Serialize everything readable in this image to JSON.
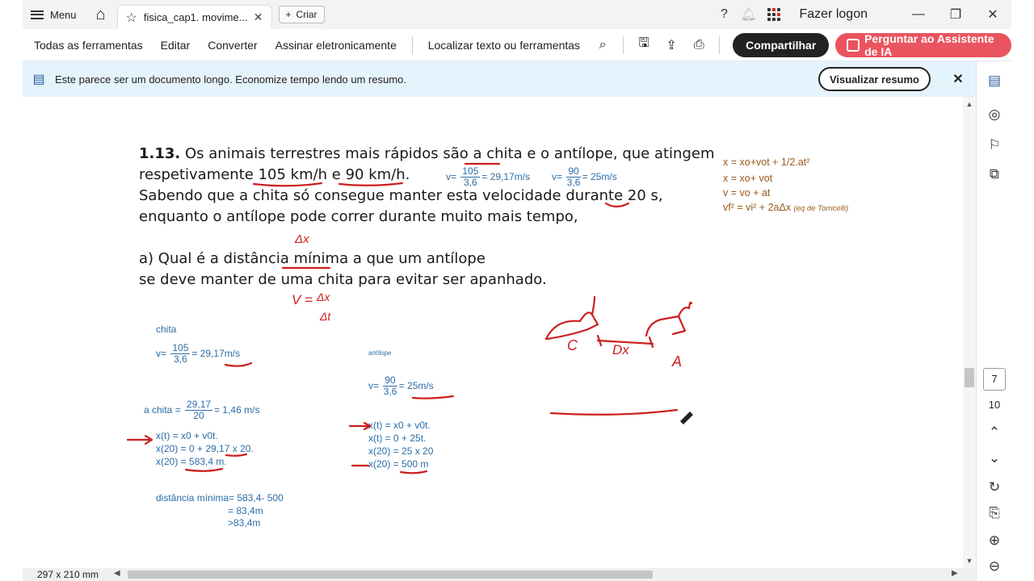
{
  "titlebar": {
    "menu_label": "Menu",
    "tab_title": "fisica_cap1. movime...",
    "create_label": "Criar",
    "logon_label": "Fazer logon"
  },
  "toolbar": {
    "items": [
      "Todas as ferramentas",
      "Editar",
      "Converter",
      "Assinar eletronicamente"
    ],
    "find_label": "Localizar texto ou ferramentas",
    "share_label": "Compartilhar",
    "ai_label": "Perguntar ao Assistente de IA"
  },
  "banner": {
    "text": "Este parece ser um documento longo. Economize tempo lendo um resumo.",
    "button_label": "Visualizar resumo"
  },
  "navigation": {
    "current_page": "7",
    "total_pages": "10"
  },
  "statusbar": {
    "page_size": "297 x 210 mm"
  },
  "document": {
    "question_number": "1.13.",
    "line1_rest": "Os animais terrestres mais rápidos são a chita e o antílope, que atingem",
    "line2": "respetivamente 105 km/h e 90 km/h.",
    "line3": "Sabendo que a chita só consegue manter esta velocidade durante 20 s,",
    "line4": "enquanto o antílope pode correr durante muito mais tempo,",
    "line5": "a) Qual é a distância mínima a que um antílope",
    "line6": "se deve manter de uma chita para evitar ser apanhado.",
    "top_calc": {
      "v1_label": "v=",
      "v1_num": "105",
      "v1_den": "3,6",
      "v1_result": "= 29,17m/s",
      "v2_label": "v=",
      "v2_num": "90",
      "v2_den": "3,6",
      "v2_result": "= 25m/s"
    },
    "formulas": [
      "x = xo+vot + 1/2.at²",
      "x = xo+ vot",
      "v = vo + at",
      "vf² = vi² + 2aΔx"
    ],
    "torricelli_note": "(eq de Torricelli)",
    "chita": {
      "title": "chita",
      "v_label": "v=",
      "v_num": "105",
      "v_den": "3,6",
      "v_result": "= 29,17m/s",
      "a_label": "a chita =",
      "a_num": "29,17",
      "a_den": "20",
      "a_result": "= 1,46 m/s",
      "x_lines": [
        "x(t) = x0 + v0t.",
        "x(20) = 0 + 29,17 x 20.",
        "x(20) = 583,4 m."
      ]
    },
    "antilope": {
      "title": "antílope",
      "v_label": "v=",
      "v_num": "90",
      "v_den": "3,6",
      "v_result": "= 25m/s",
      "x_lines": [
        "x(t) = x0 + v0t.",
        "x(t) = 0 + 25t.",
        "x(20) = 25 x 20",
        "x(20) = 500 m"
      ]
    },
    "distance": {
      "line1": "distância mínima= 583,4- 500",
      "line2": "= 83,4m",
      "line3": ">83,4m"
    },
    "annotations": {
      "delta_x": "Δx",
      "v_formula_num": "Δx",
      "v_formula_den": "Δt",
      "v_letter": "V =",
      "c_letter": "C",
      "a_letter": "A",
      "dx_label": "Dx"
    }
  }
}
